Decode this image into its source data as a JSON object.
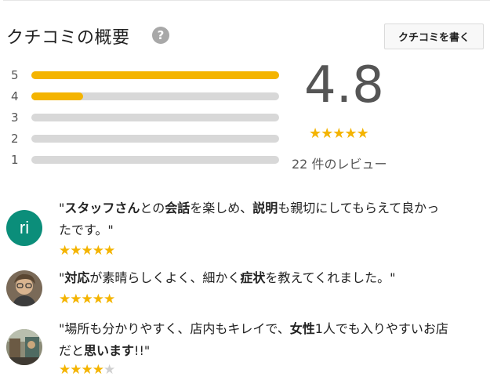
{
  "header": {
    "title": "クチコミの概要",
    "help_icon": "?",
    "write_button": "クチコミを書く"
  },
  "histogram": [
    {
      "label": "5",
      "fraction": 1.0
    },
    {
      "label": "4",
      "fraction": 0.21
    },
    {
      "label": "3",
      "fraction": 0.0
    },
    {
      "label": "2",
      "fraction": 0.0
    },
    {
      "label": "1",
      "fraction": 0.0
    }
  ],
  "summary": {
    "rating": "4.8",
    "stars": 5,
    "review_count": "22 件のレビュー"
  },
  "reviews": [
    {
      "avatar_text": "ri",
      "avatar_color": "#0b8e7a",
      "line1": [
        "\"",
        "スタッフさん",
        "との",
        "会話",
        "を楽しめ、",
        "説明",
        "も親切にしてもらえて良かっ"
      ],
      "line2": "たです。\"",
      "stars": 5
    },
    {
      "avatar_text": "",
      "line1": [
        "\"",
        "対応",
        "が素晴らしくよく、細かく",
        "症状",
        "を教えてくれました。\""
      ],
      "stars": 5
    },
    {
      "avatar_text": "",
      "line1": [
        "\"場所も分かりやすく、店内もキレイで、",
        "女性",
        "1人でも入りやすいお店"
      ],
      "line2": [
        "だと",
        "思います",
        "!!\""
      ],
      "stars": 4
    }
  ],
  "colors": {
    "star": "#f4b400",
    "bar_fill": "#f4b400",
    "bar_track": "#d8d8d8",
    "help_icon_bg": "#a8a8a8"
  }
}
